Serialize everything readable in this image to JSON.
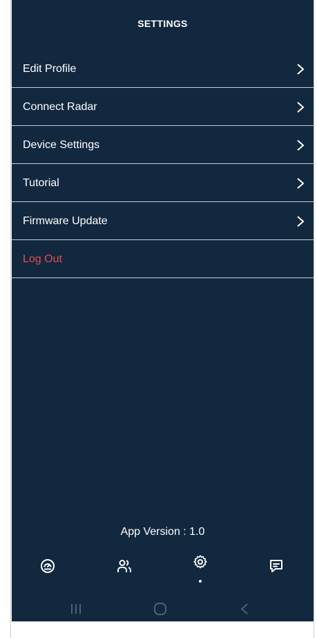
{
  "header": {
    "title": "SETTINGS"
  },
  "menu": {
    "items": [
      {
        "label": "Edit Profile",
        "has_chevron": true
      },
      {
        "label": "Connect Radar",
        "has_chevron": true
      },
      {
        "label": "Device Settings",
        "has_chevron": true
      },
      {
        "label": "Tutorial",
        "has_chevron": true
      },
      {
        "label": "Firmware Update",
        "has_chevron": true
      },
      {
        "label": "Log Out",
        "has_chevron": false
      }
    ]
  },
  "footer": {
    "version": "App Version : 1.0"
  },
  "tabbar": {
    "tabs": [
      {
        "icon": "dashboard-icon"
      },
      {
        "icon": "users-icon"
      },
      {
        "icon": "gear-icon",
        "active": true
      },
      {
        "icon": "chat-icon"
      }
    ]
  },
  "system_nav": {
    "buttons": [
      "recent-apps-icon",
      "home-icon",
      "back-icon"
    ]
  },
  "colors": {
    "background": "#12283f",
    "divider": "#c8ced6",
    "text": "#ffffff",
    "danger": "#e34b4b",
    "system_nav_icons": "#4f6275"
  }
}
